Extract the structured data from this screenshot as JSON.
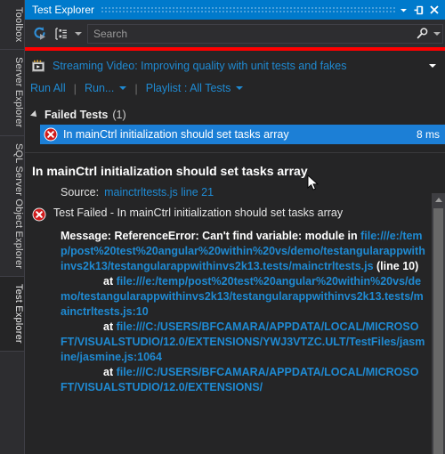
{
  "window": {
    "title": "Test Explorer",
    "controls": [
      {
        "name": "dropdown-chevron",
        "icon": "chevron-down-icon"
      },
      {
        "name": "pin",
        "icon": "pin-icon"
      },
      {
        "name": "close",
        "icon": "close-icon"
      }
    ],
    "accent_color": "#007acc",
    "background_color": "#252526"
  },
  "vertical_tabs": [
    {
      "label": "Toolbox",
      "selected": false
    },
    {
      "label": "Server Explorer",
      "selected": false
    },
    {
      "label": "SQL Server Object Explorer",
      "selected": false
    },
    {
      "label": "Test Explorer",
      "selected": true
    }
  ],
  "toolbar": {
    "run_after_build_icon": "run-refresh-icon",
    "group_by_icon": "group-by-icon",
    "group_by_caret": "chevron-down-icon",
    "search_placeholder": "Search",
    "search_value": "",
    "search_icon": "search-icon",
    "search_caret": "chevron-down-icon"
  },
  "status": {
    "progress_color": "#ff0000"
  },
  "video": {
    "icon": "video-icon",
    "text": "Streaming Video: Improving quality with unit tests and fakes",
    "caret": "chevron-down-icon"
  },
  "commands": {
    "run_all": "Run All",
    "separator": "|",
    "run": "Run...",
    "playlist": "Playlist : All Tests"
  },
  "test_group": {
    "label": "Failed Tests",
    "count": "(1)",
    "expanded": true
  },
  "test_row": {
    "status_icon": "error-icon",
    "name": "In mainCtrl initialization should set tasks array",
    "duration": "8 ms",
    "selected": true,
    "highlight_color": "#1c7fd6"
  },
  "detail": {
    "title": "In mainCtrl initialization should set tasks array",
    "source_label": "Source:",
    "source_link": "mainctrltests.js line 21",
    "fail_icon": "error-icon",
    "fail_text": "Test Failed - In mainCtrl initialization should set tasks array",
    "message_prefix": "Message: ReferenceError: Can't find variable: module in ",
    "message_url": "file:///e:/temp/post%20test%20angular%20within%20vs/demo/testangularappwithinvs2k13/testangularappwithinvs2k13.tests/mainctrltests.js",
    "message_suffix": " (line 10)",
    "stack": [
      {
        "at": "at",
        "url": "file:///e:/temp/post%20test%20angular%20within%20vs/demo/testangularappwithinvs2k13/testangularappwithinvs2k13.tests/mainctrltests.js:10"
      },
      {
        "at": "at",
        "url": "file:///C:/USERS/BFCAMARA/APPDATA/LOCAL/MICROSOFT/VISUALSTUDIO/12.0/EXTENSIONS/YWJ3VTZC.ULT/TestFiles/jasmine/jasmine.js:1064"
      },
      {
        "at": "at",
        "url": "file:///C:/USERS/BFCAMARA/APPDATA/LOCAL/MICROSOFT/VISUALSTUDIO/12.0/EXTENSIONS/"
      }
    ]
  }
}
